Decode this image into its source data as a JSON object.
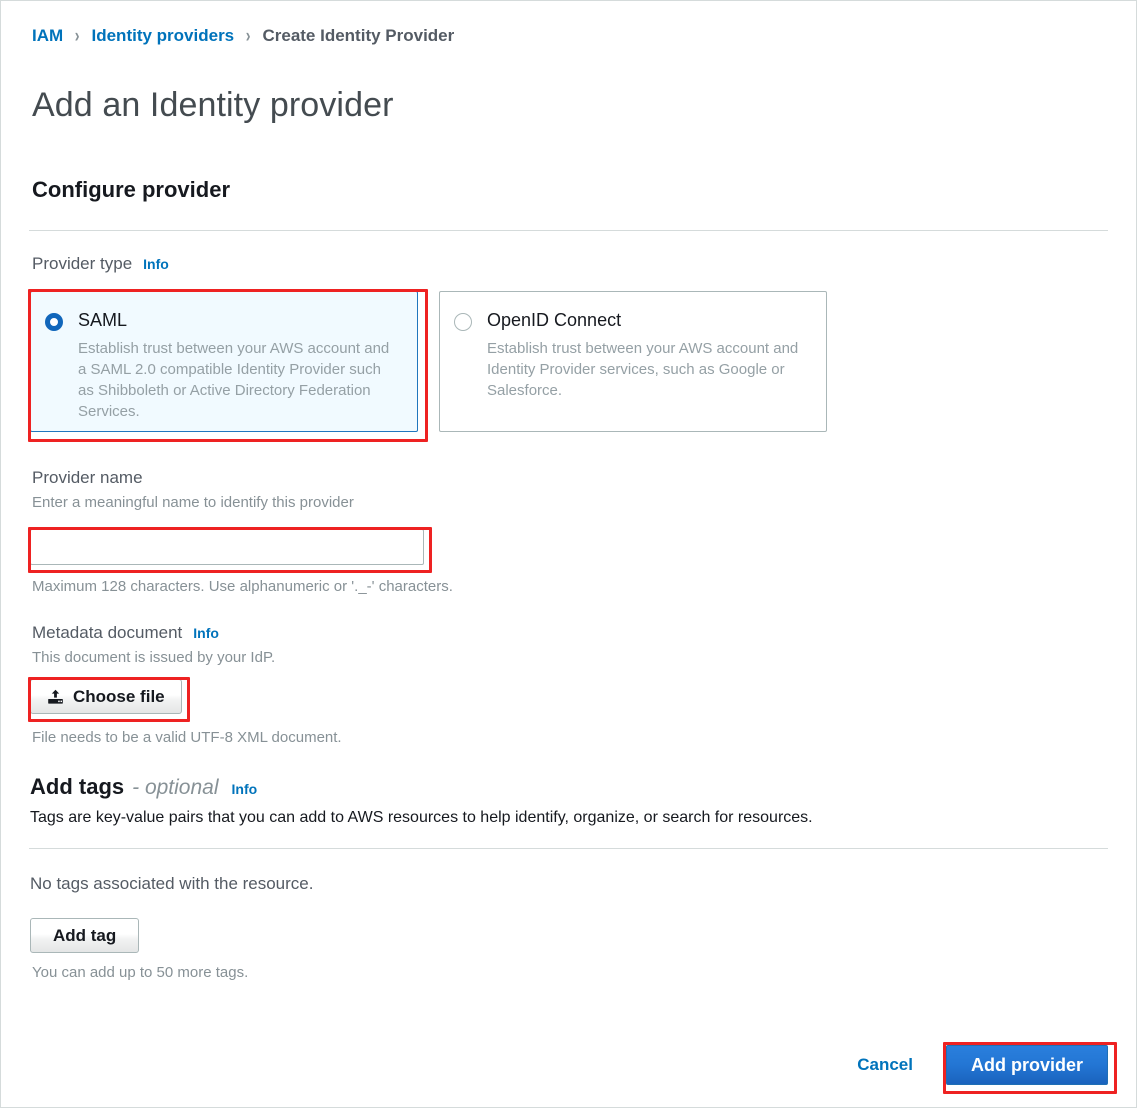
{
  "breadcrumb": {
    "items": [
      {
        "label": "IAM",
        "current": false
      },
      {
        "label": "Identity providers",
        "current": false
      },
      {
        "label": "Create Identity Provider",
        "current": true
      }
    ],
    "separator": "›"
  },
  "page": {
    "title": "Add an Identity provider",
    "section_title": "Configure provider"
  },
  "provider_type": {
    "label": "Provider type",
    "info_label": "Info",
    "options": [
      {
        "id": "saml",
        "title": "SAML",
        "description": "Establish trust between your AWS account and a SAML 2.0 compatible Identity Provider such as Shibboleth or Active Directory Federation Services.",
        "selected": true
      },
      {
        "id": "oidc",
        "title": "OpenID Connect",
        "description": "Establish trust between your AWS account and Identity Provider services, such as Google or Salesforce.",
        "selected": false
      }
    ]
  },
  "provider_name": {
    "label": "Provider name",
    "description": "Enter a meaningful name to identify this provider",
    "value": "",
    "placeholder": "",
    "constraint": "Maximum 128 characters. Use alphanumeric or '._-' characters."
  },
  "metadata_document": {
    "label": "Metadata document",
    "info_label": "Info",
    "description": "This document is issued by your IdP.",
    "button_label": "Choose file",
    "button_icon": "upload-icon",
    "constraint": "File needs to be a valid UTF-8 XML document."
  },
  "add_tags": {
    "title": "Add tags",
    "optional_label": "- optional",
    "info_label": "Info",
    "description": "Tags are key-value pairs that you can add to AWS resources to help identify, organize, or search for resources.",
    "empty_message": "No tags associated with the resource.",
    "add_button_label": "Add tag",
    "limit_message": "You can add up to 50 more tags."
  },
  "footer": {
    "cancel_label": "Cancel",
    "submit_label": "Add provider"
  },
  "colors": {
    "link": "#0073bb",
    "primary_button": "#2376d4",
    "annotation": "#ee2222",
    "selected_card_bg": "#f1faff",
    "selected_card_border": "#2176bd",
    "radio_selected": "#1166bb"
  }
}
